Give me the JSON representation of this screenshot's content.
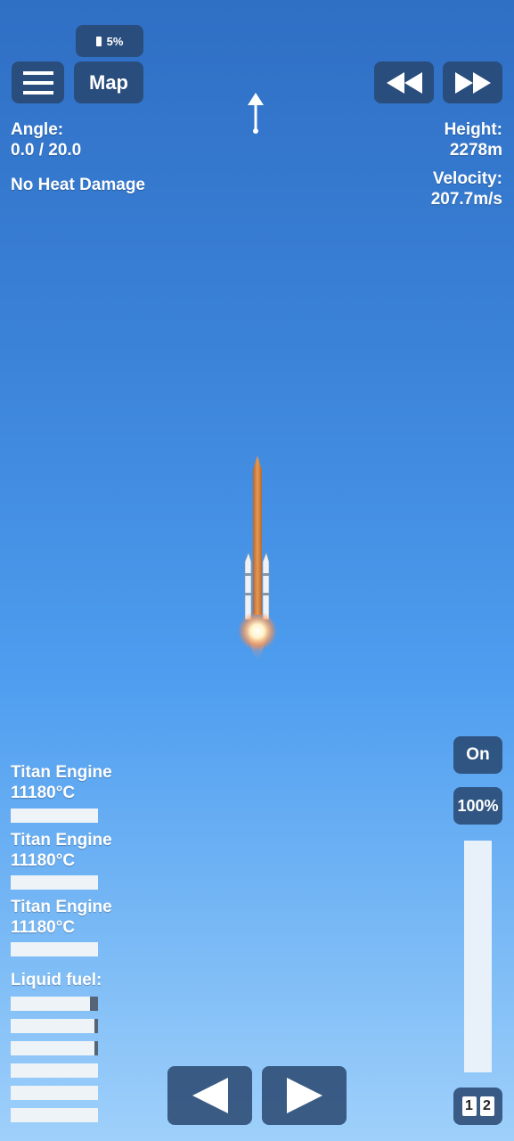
{
  "battery": {
    "label": "5%",
    "icon": "battery-icon"
  },
  "toolbar": {
    "map_label": "Map",
    "menu_icon": "hamburger-menu-icon",
    "rewind_icon": "rewind-icon",
    "fastforward_icon": "fast-forward-icon"
  },
  "direction_icon": "up-arrow-icon",
  "hud": {
    "angle_label": "Angle:",
    "angle_value": "0.0 / 20.0",
    "heat_status": "No Heat Damage",
    "height_label": "Height:",
    "height_value": "2278m",
    "velocity_label": "Velocity:",
    "velocity_value": "207.7m/s"
  },
  "engines": [
    {
      "name": "Titan Engine",
      "temp": "11180°C"
    },
    {
      "name": "Titan Engine",
      "temp": "11180°C"
    },
    {
      "name": "Titan Engine",
      "temp": "11180°C"
    }
  ],
  "fuel": {
    "label": "Liquid fuel:",
    "levels": [
      0.09,
      0.04,
      0.04,
      0,
      0,
      0
    ]
  },
  "controls": {
    "engine_toggle": "On",
    "throttle_label": "100%",
    "throttle_level": 1.0,
    "stage_1": "1",
    "stage_2": "2",
    "rotate_left_icon": "left-arrow-icon",
    "rotate_right_icon": "right-arrow-icon"
  },
  "colors": {
    "button_bg": "#28466e",
    "sky_top": "#2f6fc4",
    "sky_bottom": "#9fd0fb",
    "rocket": "#d9823f"
  }
}
